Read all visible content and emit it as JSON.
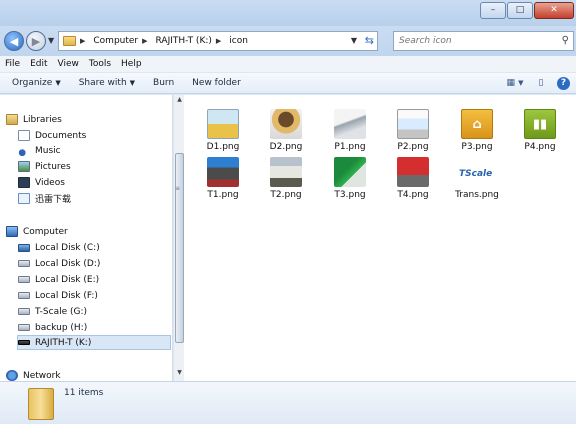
{
  "window": {
    "controls": {
      "minimize": "–",
      "maximize": "□",
      "close": "✕"
    }
  },
  "address": {
    "crumbs": [
      "Computer",
      "RAJITH-T (K:)",
      "icon"
    ]
  },
  "search": {
    "placeholder": "Search icon"
  },
  "menu": [
    "File",
    "Edit",
    "View",
    "Tools",
    "Help"
  ],
  "commands": {
    "organize": "Organize",
    "share_with": "Share with",
    "burn": "Burn",
    "new_folder": "New folder"
  },
  "nav": {
    "libraries": "Libraries",
    "lib_items": [
      "Documents",
      "Music",
      "Pictures",
      "Videos",
      "迅雷下载"
    ],
    "computer": "Computer",
    "drives": [
      "Local Disk (C:)",
      "Local Disk (D:)",
      "Local Disk (E:)",
      "Local Disk (F:)",
      "T-Scale (G:)",
      "backup (H:)",
      "RAJITH-T (K:)"
    ],
    "network": "Network"
  },
  "files": [
    {
      "name": "D1.png",
      "icon": "truck-yellow"
    },
    {
      "name": "D2.png",
      "icon": "driver-cartoon"
    },
    {
      "name": "P1.png",
      "icon": "scale-device"
    },
    {
      "name": "P2.png",
      "icon": "receipt-printer"
    },
    {
      "name": "P3.png",
      "icon": "home-tile"
    },
    {
      "name": "P4.png",
      "icon": "chart-tile"
    },
    {
      "name": "T1.png",
      "icon": "bus"
    },
    {
      "name": "T2.png",
      "icon": "truck-white"
    },
    {
      "name": "T3.png",
      "icon": "truck-green"
    },
    {
      "name": "T4.png",
      "icon": "truck-red"
    },
    {
      "name": "Trans.png",
      "icon": "tscale-logo",
      "logo_text": "TScale"
    }
  ],
  "status": {
    "item_count": "11 items"
  }
}
